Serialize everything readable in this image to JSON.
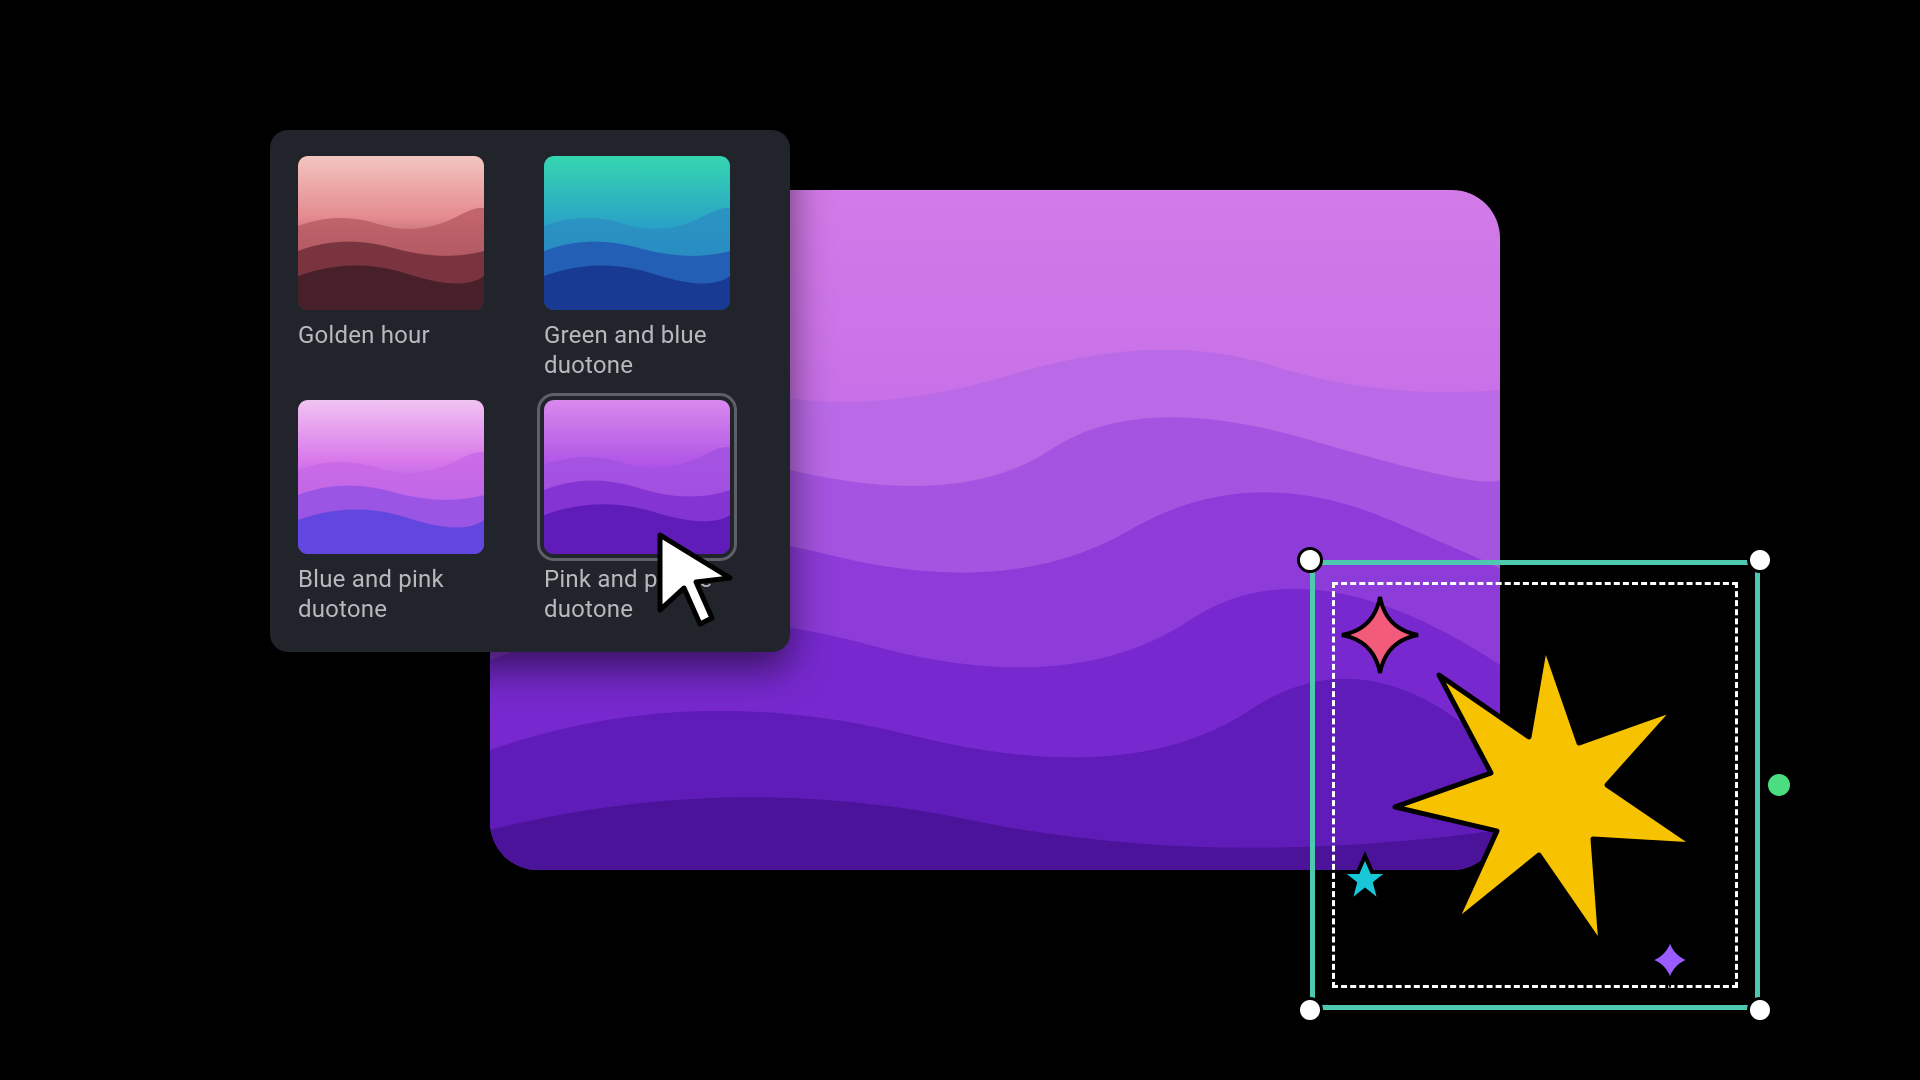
{
  "filters": {
    "items": [
      {
        "id": "golden-hour",
        "label": "Golden hour",
        "selected": false
      },
      {
        "id": "green-blue",
        "label": "Green and blue duotone",
        "selected": false
      },
      {
        "id": "blue-pink",
        "label": "Blue and pink duotone",
        "selected": false
      },
      {
        "id": "pink-purple",
        "label": "Pink and purple duotone",
        "selected": true
      }
    ]
  },
  "canvas": {
    "applied_filter": "Pink and purple duotone"
  },
  "selection": {
    "object": "star-group",
    "handles": [
      "top-left",
      "top-right",
      "bottom-left",
      "bottom-right",
      "rotate-right"
    ]
  },
  "colors": {
    "panel_bg": "#22242b",
    "label": "#b8b9bf",
    "selection_border": "#4ec9b0",
    "rotate_handle": "#4ade80"
  }
}
